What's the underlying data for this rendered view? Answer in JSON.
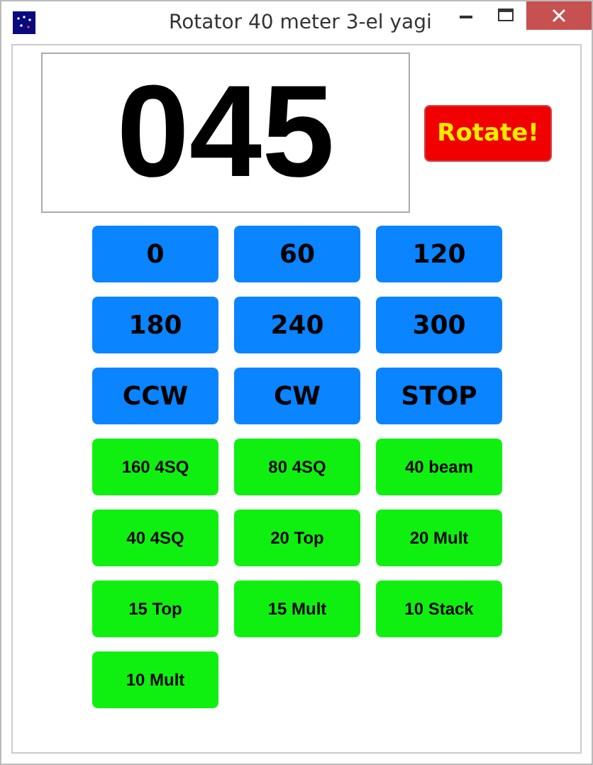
{
  "window": {
    "title": "Rotator 40 meter 3-el yagi"
  },
  "display": {
    "value": "045"
  },
  "rotate_button": {
    "label": "Rotate!"
  },
  "buttons": [
    {
      "label": "0",
      "kind": "heading"
    },
    {
      "label": "60",
      "kind": "heading"
    },
    {
      "label": "120",
      "kind": "heading"
    },
    {
      "label": "180",
      "kind": "heading"
    },
    {
      "label": "240",
      "kind": "heading"
    },
    {
      "label": "300",
      "kind": "heading"
    },
    {
      "label": "CCW",
      "kind": "heading"
    },
    {
      "label": "CW",
      "kind": "heading"
    },
    {
      "label": "STOP",
      "kind": "heading"
    },
    {
      "label": "160 4SQ",
      "kind": "preset"
    },
    {
      "label": "80 4SQ",
      "kind": "preset"
    },
    {
      "label": "40 beam",
      "kind": "preset"
    },
    {
      "label": "40 4SQ",
      "kind": "preset"
    },
    {
      "label": "20 Top",
      "kind": "preset"
    },
    {
      "label": "20 Mult",
      "kind": "preset"
    },
    {
      "label": "15 Top",
      "kind": "preset"
    },
    {
      "label": "15 Mult",
      "kind": "preset"
    },
    {
      "label": "10 Stack",
      "kind": "preset"
    },
    {
      "label": "10 Mult",
      "kind": "preset"
    }
  ]
}
